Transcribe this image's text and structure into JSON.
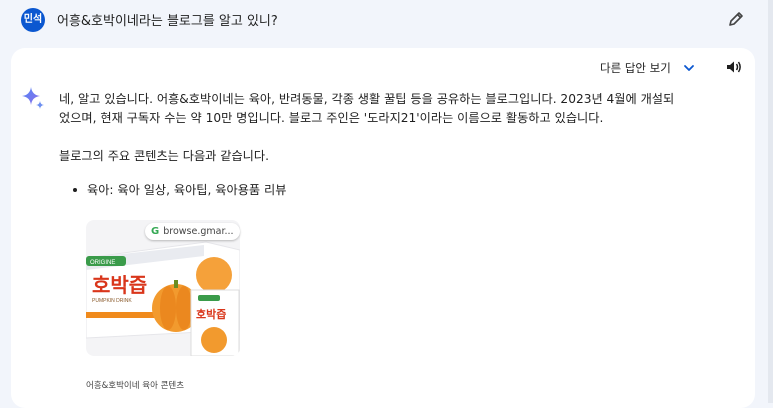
{
  "user": {
    "avatar_text": "민석",
    "prompt": "어흥&호박이네라는 블로그를 알고 있니?"
  },
  "response": {
    "drafts_label": "다른 답안 보기",
    "paragraph1_line1": "네, 알고 있습니다. 어흥&호박이네는 육아, 반려동물, 각종 생활 꿀팁 등을 공유하는 블로그입니다. 2023년 4월에 개설되",
    "paragraph1_line2": "었으며, 현재 구독자 수는 약 10만 명입니다. 블로그 주인은 '도라지21'이라는 이름으로 활동하고 있습니다.",
    "paragraph2": "블로그의 주요 콘텐츠는 다음과 같습니다.",
    "bullets": [
      {
        "text": "육아: 육아 일상, 육아팁, 육아용품 리뷰"
      }
    ],
    "image": {
      "source_chip": "browse.gmar...",
      "caption": "어흥&호박이네 육아 콘텐츠",
      "product_brand": "ORIGINE",
      "product_title": "호박즙",
      "product_subtitle": "PUMPKIN DRINK",
      "pouch_title": "호박즙"
    }
  },
  "icons": {
    "edit": "pencil-icon",
    "chevron": "chevron-down-icon",
    "speaker": "speaker-icon",
    "spark": "gemini-spark-icon",
    "source": "google-g-icon"
  },
  "colors": {
    "background": "#f2f5fb",
    "card": "#ffffff",
    "avatar": "#0b57d0",
    "accent": "#0b57d0",
    "pumpkin": "#f08a1c"
  }
}
